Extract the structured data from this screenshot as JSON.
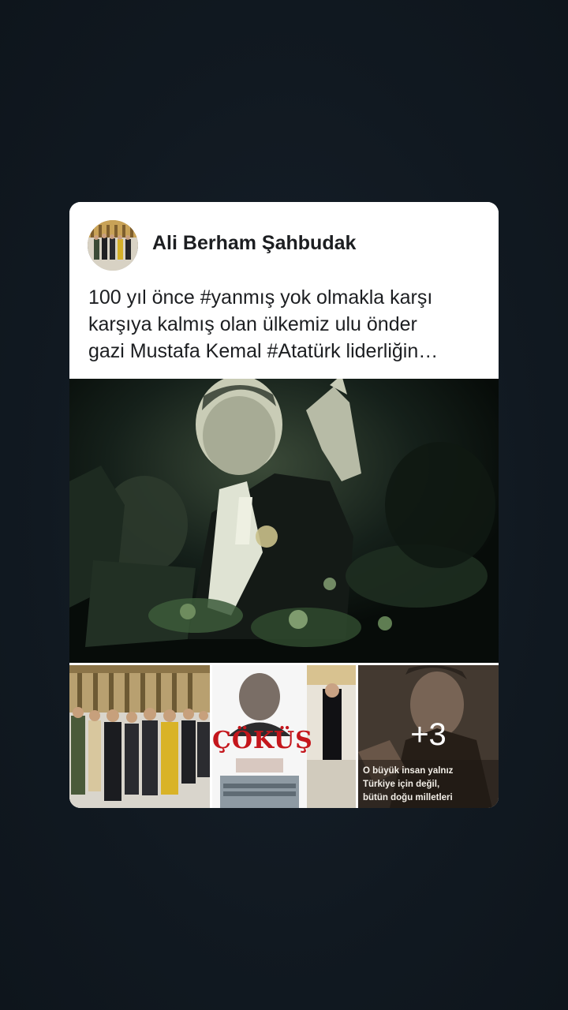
{
  "post": {
    "author": "Ali Berham Şahbudak",
    "text_lines": [
      "100 yıl önce #yanmış yok olmakla karşı",
      "karşıya kalmış olan ülkemiz ulu önder",
      "gazi Mustafa Kemal #Atatürk liderliğin…"
    ],
    "more_photos": "+3",
    "thumb_2_title": "ÇÖKÜŞ",
    "thumb_4_quote_lines": [
      "O büyük insan yalnız",
      "Türkiye için değil,",
      "bütün doğu milletleri"
    ]
  },
  "colors": {
    "background": "#121a22",
    "card": "#ffffff",
    "text": "#1c1e21",
    "cokus_red": "#c4161c"
  },
  "icons": [
    "avatar-photo"
  ]
}
